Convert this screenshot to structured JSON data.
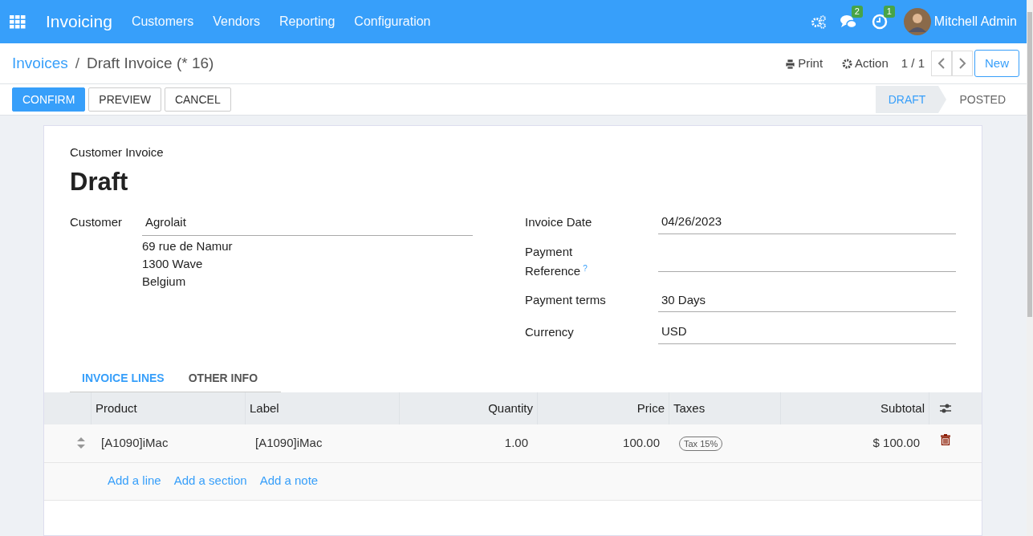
{
  "navbar": {
    "app_title": "Invoicing",
    "menu": [
      "Customers",
      "Vendors",
      "Reporting",
      "Configuration"
    ],
    "notifications": [
      {
        "kind": "chat",
        "badge": "2"
      },
      {
        "kind": "activity",
        "badge": "1"
      }
    ],
    "user": "Mitchell Admin"
  },
  "breadcrumb_separator": "/",
  "breadcrumb": [
    {
      "label": "Invoices",
      "kind": "link"
    },
    {
      "label": "Draft Invoice (* 16)",
      "kind": "current"
    }
  ],
  "actions": [
    {
      "label": "Print",
      "kind": "print"
    },
    {
      "label": "Action",
      "kind": "gear"
    }
  ],
  "pager": "1 / 1",
  "new_button": "New",
  "buttons": [
    {
      "label": "CONFIRM",
      "primary": true
    },
    {
      "label": "PREVIEW",
      "primary": false
    },
    {
      "label": "CANCEL",
      "primary": false
    }
  ],
  "statusbar": [
    {
      "label": "DRAFT",
      "selected": true
    },
    {
      "label": "POSTED",
      "selected": false
    }
  ],
  "sheet": {
    "subtitle": "Customer Invoice",
    "title": "Draft",
    "customer": {
      "label": "Customer",
      "name": "Agrolait",
      "address": [
        "69 rue de Namur",
        "1300 Wave",
        "Belgium"
      ]
    },
    "fields": [
      {
        "label": "Invoice Date",
        "value": "04/26/2023"
      },
      {
        "label": "Payment Reference",
        "help": "?"
      },
      {
        "label": "Payment terms",
        "value": "30 Days"
      },
      {
        "label": "Currency",
        "value": "USD"
      }
    ],
    "tabs": [
      {
        "label": "INVOICE LINES",
        "selected": true
      },
      {
        "label": "OTHER INFO",
        "selected": false
      }
    ],
    "table": {
      "columns": [
        {
          "label": "Product",
          "kind": "text"
        },
        {
          "label": "Label",
          "kind": "text"
        },
        {
          "label": "Quantity",
          "kind": "number"
        },
        {
          "label": "Price",
          "kind": "number"
        },
        {
          "label": "Taxes",
          "kind": "text"
        },
        {
          "label": "Subtotal",
          "kind": "number"
        }
      ],
      "rows": [
        {
          "cells": [
            "[A1090]iMac",
            "[A1090]iMac",
            "1.00",
            "100.00",
            null,
            "$ 100.00"
          ],
          "taxes": [
            "Tax 15%"
          ]
        }
      ],
      "add_links": [
        "Add a line",
        "Add a section",
        "Add a note"
      ]
    }
  }
}
